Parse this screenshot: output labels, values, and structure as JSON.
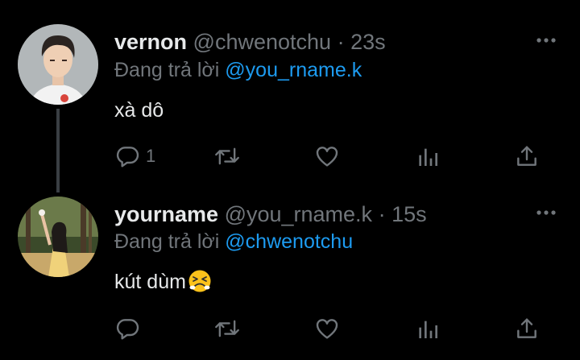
{
  "tweets": [
    {
      "name": "vernon",
      "handle": "@chwenotchu",
      "separator": "·",
      "time": "23s",
      "reply_prefix": "Đang trả lời",
      "reply_to": "@you_rname.k",
      "text": "xà dô",
      "reply_count": "1",
      "avatar": "avatar-photo"
    },
    {
      "name": "yourname",
      "handle": "@you_rname.k",
      "separator": "·",
      "time": "15s",
      "reply_prefix": "Đang trả lời",
      "reply_to": "@chwenotchu",
      "text": "kút dùm",
      "text_emoji": "persevering-face-emoji",
      "reply_count": "",
      "avatar": "avatar-photo"
    }
  ],
  "icons": {
    "reply": "reply-icon",
    "retweet": "retweet-icon",
    "like": "like-icon",
    "analytics": "analytics-icon",
    "share": "share-icon",
    "more": "more-icon"
  },
  "colors": {
    "background": "#000000",
    "primary_text": "#e7e9ea",
    "secondary_text": "#71767b",
    "link": "#1d9bf0"
  }
}
